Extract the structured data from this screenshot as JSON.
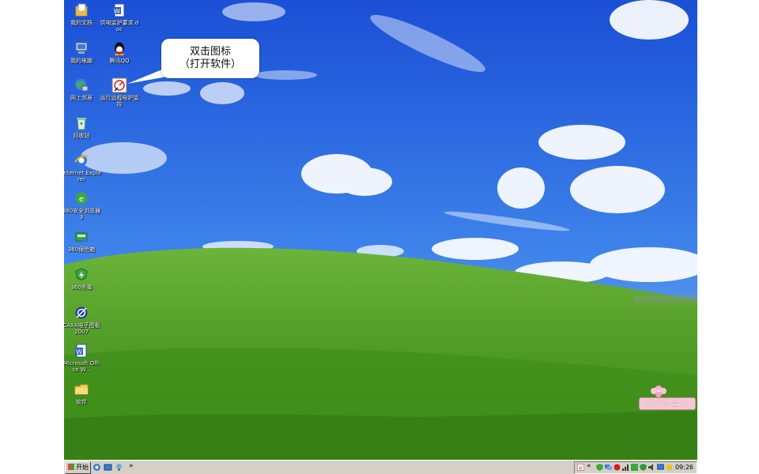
{
  "desktop": {
    "icons": [
      {
        "label": "我的文档"
      },
      {
        "label": "我的电脑"
      },
      {
        "label": "网上邻居"
      },
      {
        "label": "回收站"
      },
      {
        "label": "Internet Explorer"
      },
      {
        "label": "360安全浏览器 3"
      },
      {
        "label": "360保险箱"
      },
      {
        "label": "360杀毒"
      },
      {
        "label": "CAXA电子图板2007"
      },
      {
        "label": "Microsoft Office W..."
      },
      {
        "label": "软件"
      }
    ],
    "icons_col2": [
      {
        "label": "供电监护要求.doc"
      },
      {
        "label": "腾讯QQ"
      },
      {
        "label": "运行远程电护监控"
      }
    ]
  },
  "callout": {
    "line1": "双击图标",
    "line2": "（打开软件）"
  },
  "ime_bar": {
    "label": "中 ˚ 简 ▤ ⚙"
  },
  "taskbar": {
    "start_label": "开始",
    "chevron": "»",
    "tray_chevron": "«",
    "clock": "09:26"
  },
  "colors": {
    "sky_top": "#1a53d8",
    "sky_bottom": "#5a9cf0",
    "hill": "#4f9a2a",
    "taskbar": "#d4d0c8"
  }
}
